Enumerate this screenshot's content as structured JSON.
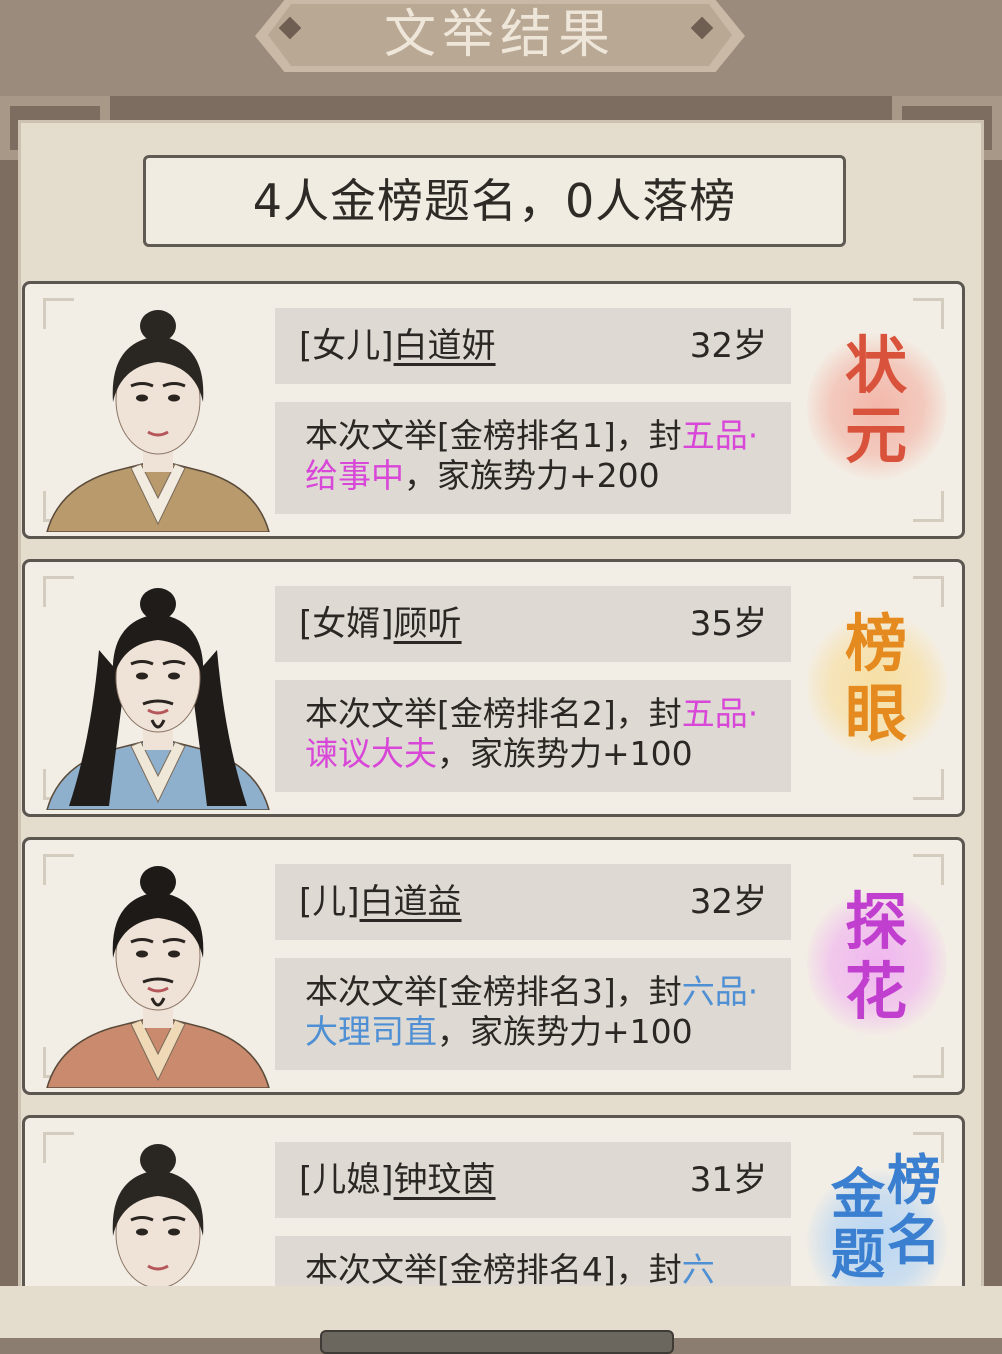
{
  "title": "文举结果",
  "summary": "4人金榜题名，0人落榜",
  "cards": [
    {
      "relation": "[女儿]",
      "name": "白道妍",
      "age": "32岁",
      "desc_prefix": "本次文举[金榜排名1]，封",
      "rank_title": "五品·给事中",
      "rank_color": "#d847d8",
      "desc_suffix": "，家族势力+200",
      "badge": [
        "状",
        "元"
      ],
      "badge_color": "#d9533c",
      "badge_glow": "#f3b7aa",
      "badge_layout": "vertical"
    },
    {
      "relation": "[女婿]",
      "name": "顾听",
      "age": "35岁",
      "desc_prefix": "本次文举[金榜排名2]，封",
      "rank_title": "五品·谏议大夫",
      "rank_color": "#d847d8",
      "desc_suffix": "，家族势力+100",
      "badge": [
        "榜",
        "眼"
      ],
      "badge_color": "#e58a1e",
      "badge_glow": "#f7dfa3",
      "badge_layout": "vertical"
    },
    {
      "relation": "[儿]",
      "name": "白道益",
      "age": "32岁",
      "desc_prefix": "本次文举[金榜排名3]，封",
      "rank_title": "六品·大理司直",
      "rank_color": "#4f8fd3",
      "desc_suffix": "，家族势力+100",
      "badge": [
        "探",
        "花"
      ],
      "badge_color": "#c13fcf",
      "badge_glow": "#f0b6ef",
      "badge_layout": "vertical"
    },
    {
      "relation": "[儿媳]",
      "name": "钟玟茵",
      "age": "31岁",
      "desc_prefix": "本次文举[金榜排名4]，封",
      "rank_title": "六",
      "rank_color": "#4f8fd3",
      "desc_suffix": "",
      "badge": [
        "金",
        "榜",
        "题",
        "名"
      ],
      "badge_color": "#3a7fd0",
      "badge_glow": "#b9d6f3",
      "badge_layout": "grid"
    }
  ],
  "portraits": [
    {
      "robe": "#b89a6c",
      "inner": "#f2ece0",
      "hair": "#2a2622",
      "skin": "#efe3d8"
    },
    {
      "robe": "#8fb0cc",
      "inner": "#efe8d8",
      "hair": "#1f1c1a",
      "skin": "#efe3d8"
    },
    {
      "robe": "#c98a6e",
      "inner": "#efd9b6",
      "hair": "#1d1a18",
      "skin": "#efe2d6"
    },
    {
      "robe": "#b89a6c",
      "inner": "#f2ece0",
      "hair": "#2a2622",
      "skin": "#efe3d8"
    }
  ]
}
